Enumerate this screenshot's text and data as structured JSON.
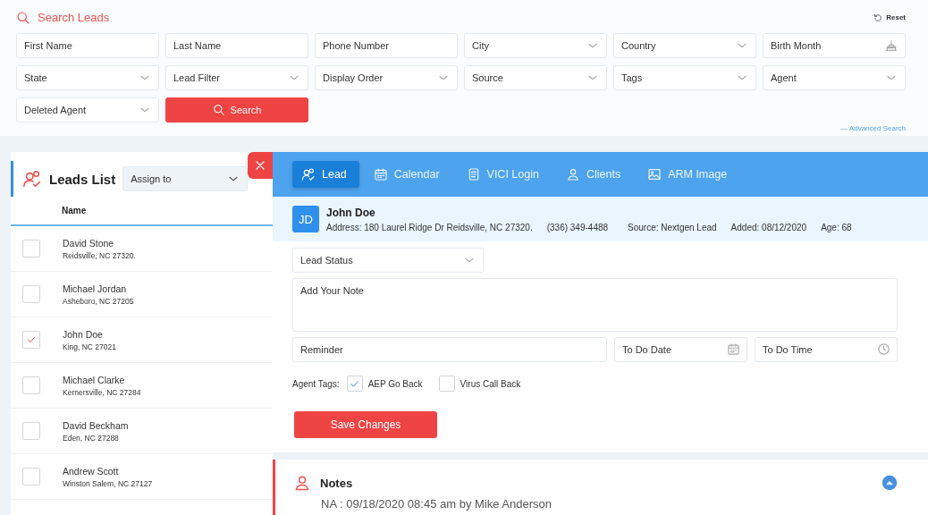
{
  "search": {
    "title": "Search Leads",
    "reset": "Reset",
    "fields": [
      {
        "placeholder": "First Name",
        "kind": "text"
      },
      {
        "placeholder": "Last Name",
        "kind": "text"
      },
      {
        "placeholder": "Phone Number",
        "kind": "text"
      },
      {
        "placeholder": "City",
        "kind": "select"
      },
      {
        "placeholder": "Country",
        "kind": "select"
      },
      {
        "placeholder": "Birth Month",
        "kind": "birthday"
      },
      {
        "placeholder": "State",
        "kind": "select"
      },
      {
        "placeholder": "Lead Filter",
        "kind": "select"
      },
      {
        "placeholder": "Display Order",
        "kind": "select"
      },
      {
        "placeholder": "Source",
        "kind": "select"
      },
      {
        "placeholder": "Tags",
        "kind": "select"
      },
      {
        "placeholder": "Agent",
        "kind": "select"
      },
      {
        "placeholder": "Deleted Agent",
        "kind": "select"
      }
    ],
    "button": "Search",
    "advanced": "— Advanced Search"
  },
  "leads_list": {
    "title": "Leads List",
    "assign": "Assign to",
    "column": "Name",
    "rows": [
      {
        "name": "David Stone",
        "location": "Reidsville, NC 27320.",
        "checked": false
      },
      {
        "name": "Michael Jordan",
        "location": "Asheboro, NC 27205",
        "checked": false
      },
      {
        "name": "John Doe",
        "location": "King, NC 27021",
        "checked": true
      },
      {
        "name": "Michael Clarke",
        "location": "Kernersville, NC 27284",
        "checked": false
      },
      {
        "name": "David Beckham",
        "location": "Eden, NC 27288",
        "checked": false
      },
      {
        "name": "Andrew Scott",
        "location": "Winston Salem, NC 27127",
        "checked": false
      }
    ]
  },
  "tabs": [
    {
      "label": "Lead",
      "selected": true
    },
    {
      "label": "Calendar",
      "selected": false
    },
    {
      "label": "VICI Login",
      "selected": false
    },
    {
      "label": "Clients",
      "selected": false
    },
    {
      "label": "ARM Image",
      "selected": false
    }
  ],
  "lead": {
    "initials": "JD",
    "name": "John Doe",
    "address": "Address: 180 Laurel Ridge Dr Reidsville, NC 27320.",
    "phone": "(336) 349-4488",
    "source": "Source: Nextgen Lead",
    "added": "Added: 08/12/2020",
    "age": "Age: 68"
  },
  "form": {
    "status": "Lead Status",
    "note": {
      "placeholder": "Add Your Note"
    },
    "reminder": {
      "placeholder": "Reminder"
    },
    "date": {
      "placeholder": "To Do Date"
    },
    "time": {
      "placeholder": "To Do Time"
    },
    "tags_label": "Agent Tags:",
    "tags": [
      {
        "label": "AEP Go Back",
        "checked": true
      },
      {
        "label": "Virus Call Back",
        "checked": false
      }
    ],
    "save": "Save Changes"
  },
  "notes": {
    "title": "Notes",
    "entries": [
      "NA : 09/18/2020 08:45 am by Mike Anderson"
    ]
  }
}
